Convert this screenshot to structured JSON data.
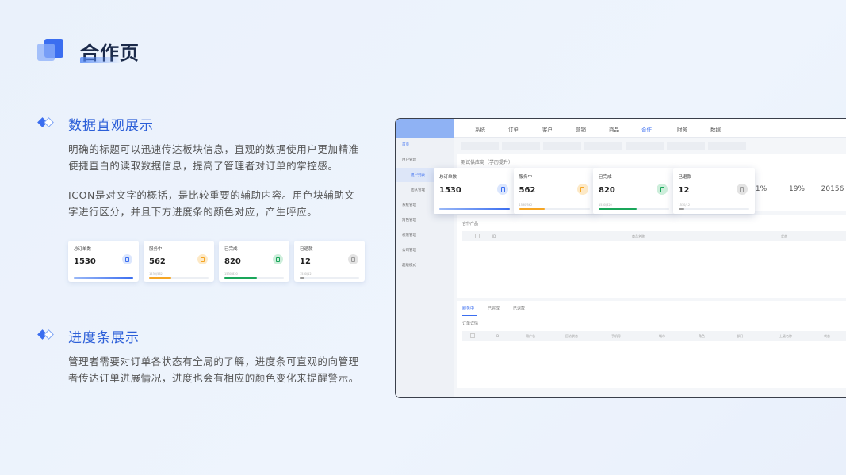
{
  "page": {
    "title": "合作页"
  },
  "section1": {
    "title": "数据直观展示",
    "p1": "明确的标题可以迅速传达板块信息，直观的数据使用户更加精准便捷直白的读取数据信息，提高了管理者对订单的掌控感。",
    "p2": "ICON是对文字的概括，是比较重要的辅助内容。用色块辅助文字进行区分，并且下方进度条的颜色对应，产生呼应。"
  },
  "section2": {
    "title": "进度条展示",
    "p1": "管理者需要对订单各状态有全局的了解，进度条可直观的向管理者传达订单进展情况，进度也会有相应的颜色变化来提醒警示。"
  },
  "stat_cards": [
    {
      "label": "总订单数",
      "value": "1530",
      "sub": "",
      "progress": 1.0,
      "color": "#3b6ef0",
      "icon_bg": "#dbe6fd",
      "icon": "clipboard-icon"
    },
    {
      "label": "服务中",
      "value": "562",
      "sub": "1530/562",
      "progress": 0.37,
      "color": "#f5a524",
      "icon_bg": "#fde9c6",
      "icon": "clipboard-icon"
    },
    {
      "label": "已完成",
      "value": "820",
      "sub": "1530/820",
      "progress": 0.54,
      "color": "#1aa65a",
      "icon_bg": "#cdeedb",
      "icon": "clipboard-icon"
    },
    {
      "label": "已退款",
      "value": "12",
      "sub": "1530/12",
      "progress": 0.08,
      "color": "#9a9a9a",
      "icon_bg": "#e3e3e3",
      "icon": "clipboard-icon"
    }
  ],
  "app": {
    "brand": "",
    "nav": [
      "系统",
      "订单",
      "客户",
      "营销",
      "商品",
      "合作",
      "财务",
      "数据"
    ],
    "nav_active": "合作",
    "sidebar": [
      "首页",
      "用户管理",
      "用户列表",
      "团队管理",
      "系统管理",
      "角色管理",
      "权限管理",
      "公司管理",
      "超级模式"
    ],
    "page_heading": "测试供应商（学历提升）",
    "stats": [
      {
        "value": "1%",
        "label": ""
      },
      {
        "value": "19%",
        "label": ""
      },
      {
        "value": "20156",
        "label": ""
      }
    ],
    "section_product": "合作产品",
    "product_cols": [
      "ID",
      "商品名称",
      "状态"
    ],
    "tabs2": [
      "服务中",
      "已完成",
      "已退款"
    ],
    "tabs2_active": "服务中",
    "section_orders": "订单详情",
    "order_cols": [
      "ID",
      "用户名",
      "回访状态",
      "手机号",
      "城市",
      "角色",
      "部门",
      "上级名称",
      "状态"
    ]
  }
}
